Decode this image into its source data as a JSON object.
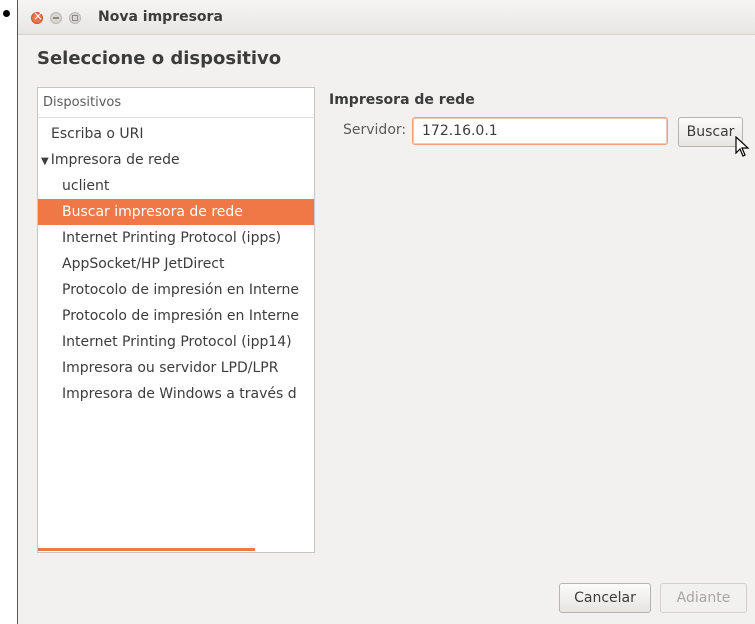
{
  "window": {
    "title": "Nova impresora"
  },
  "page": {
    "heading": "Seleccione o dispositivo"
  },
  "devices": {
    "header": "Dispositivos",
    "items": [
      {
        "label": "Escriba o URI",
        "indent": 0,
        "expander": false,
        "selected": false
      },
      {
        "label": "Impresora de rede",
        "indent": 0,
        "expander": true,
        "selected": false
      },
      {
        "label": "uclient",
        "indent": 1,
        "expander": false,
        "selected": false
      },
      {
        "label": "Buscar impresora de rede",
        "indent": 1,
        "expander": false,
        "selected": true
      },
      {
        "label": "Internet Printing Protocol (ipps)",
        "indent": 1,
        "expander": false,
        "selected": false
      },
      {
        "label": "AppSocket/HP JetDirect",
        "indent": 1,
        "expander": false,
        "selected": false
      },
      {
        "label": "Protocolo de impresión en Interne",
        "indent": 1,
        "expander": false,
        "selected": false
      },
      {
        "label": "Protocolo de impresión en Interne",
        "indent": 1,
        "expander": false,
        "selected": false
      },
      {
        "label": "Internet Printing Protocol (ipp14)",
        "indent": 1,
        "expander": false,
        "selected": false
      },
      {
        "label": "Impresora ou servidor LPD/LPR",
        "indent": 1,
        "expander": false,
        "selected": false
      },
      {
        "label": "Impresora de Windows a través d",
        "indent": 1,
        "expander": false,
        "selected": false
      }
    ]
  },
  "network": {
    "section_title": "Impresora de rede",
    "server_label": "Servidor:",
    "server_value": "172.16.0.1",
    "search_label": "Buscar"
  },
  "footer": {
    "cancel_label": "Cancelar",
    "next_label": "Adiante"
  },
  "colors": {
    "accent": "#f07746"
  }
}
